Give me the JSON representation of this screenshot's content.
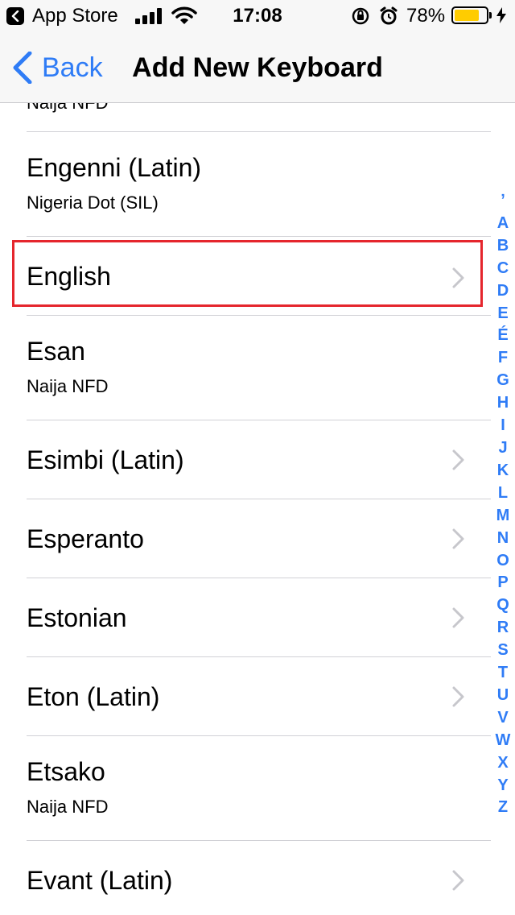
{
  "status_bar": {
    "back_app": "App Store",
    "time": "17:08",
    "battery_percent": "78%",
    "battery_level": 0.78,
    "battery_color": "#ffcc00"
  },
  "nav": {
    "back_label": "Back",
    "title": "Add New Keyboard"
  },
  "list": {
    "partial_subtitle": "Naija NFD",
    "rows": [
      {
        "title": "Engenni (Latin)",
        "subtitle": "Nigeria Dot (SIL)",
        "chevron": false
      },
      {
        "title": "English",
        "subtitle": "",
        "chevron": true,
        "highlighted": true
      },
      {
        "title": "Esan",
        "subtitle": "Naija NFD",
        "chevron": false
      },
      {
        "title": "Esimbi (Latin)",
        "subtitle": "",
        "chevron": true
      },
      {
        "title": "Esperanto",
        "subtitle": "",
        "chevron": true
      },
      {
        "title": "Estonian",
        "subtitle": "",
        "chevron": true
      },
      {
        "title": "Eton (Latin)",
        "subtitle": "",
        "chevron": true
      },
      {
        "title": "Etsako",
        "subtitle": "Naija NFD",
        "chevron": false
      },
      {
        "title": "Evant (Latin)",
        "subtitle": "",
        "chevron": true
      }
    ]
  },
  "index_letters": [
    "ʼ",
    "A",
    "B",
    "C",
    "D",
    "E",
    "É",
    "F",
    "G",
    "H",
    "I",
    "J",
    "K",
    "L",
    "M",
    "N",
    "O",
    "P",
    "Q",
    "R",
    "S",
    "T",
    "U",
    "V",
    "W",
    "X",
    "Y",
    "Z"
  ],
  "colors": {
    "accent": "#2f7cf6",
    "highlight": "#e5262d"
  }
}
